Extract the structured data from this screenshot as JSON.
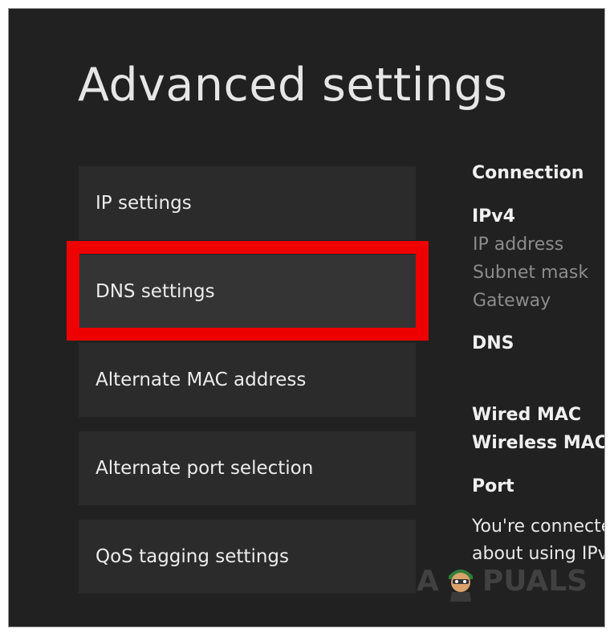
{
  "header": {
    "title": "Advanced settings"
  },
  "menu": {
    "items": [
      {
        "label": "IP settings"
      },
      {
        "label": "DNS settings"
      },
      {
        "label": "Alternate MAC address"
      },
      {
        "label": "Alternate port selection"
      },
      {
        "label": "QoS tagging settings"
      }
    ],
    "highlight_color": "#ee0000"
  },
  "info_panel": {
    "connection": "Connection",
    "ipv4": "IPv4",
    "ip_address": "IP address",
    "subnet_mask": "Subnet mask",
    "gateway": "Gateway",
    "dns": "DNS",
    "wired_mac": "Wired MAC",
    "wireless_mac": "Wireless MAC",
    "port": "Port",
    "connected_line1": "You're connecte",
    "connected_line2": "about using IPv"
  },
  "watermark": {
    "prefix": "A",
    "suffix": "PUALS"
  },
  "colors": {
    "background": "#212121",
    "panel": "#2b2b2b",
    "accent": "#ee0000"
  }
}
